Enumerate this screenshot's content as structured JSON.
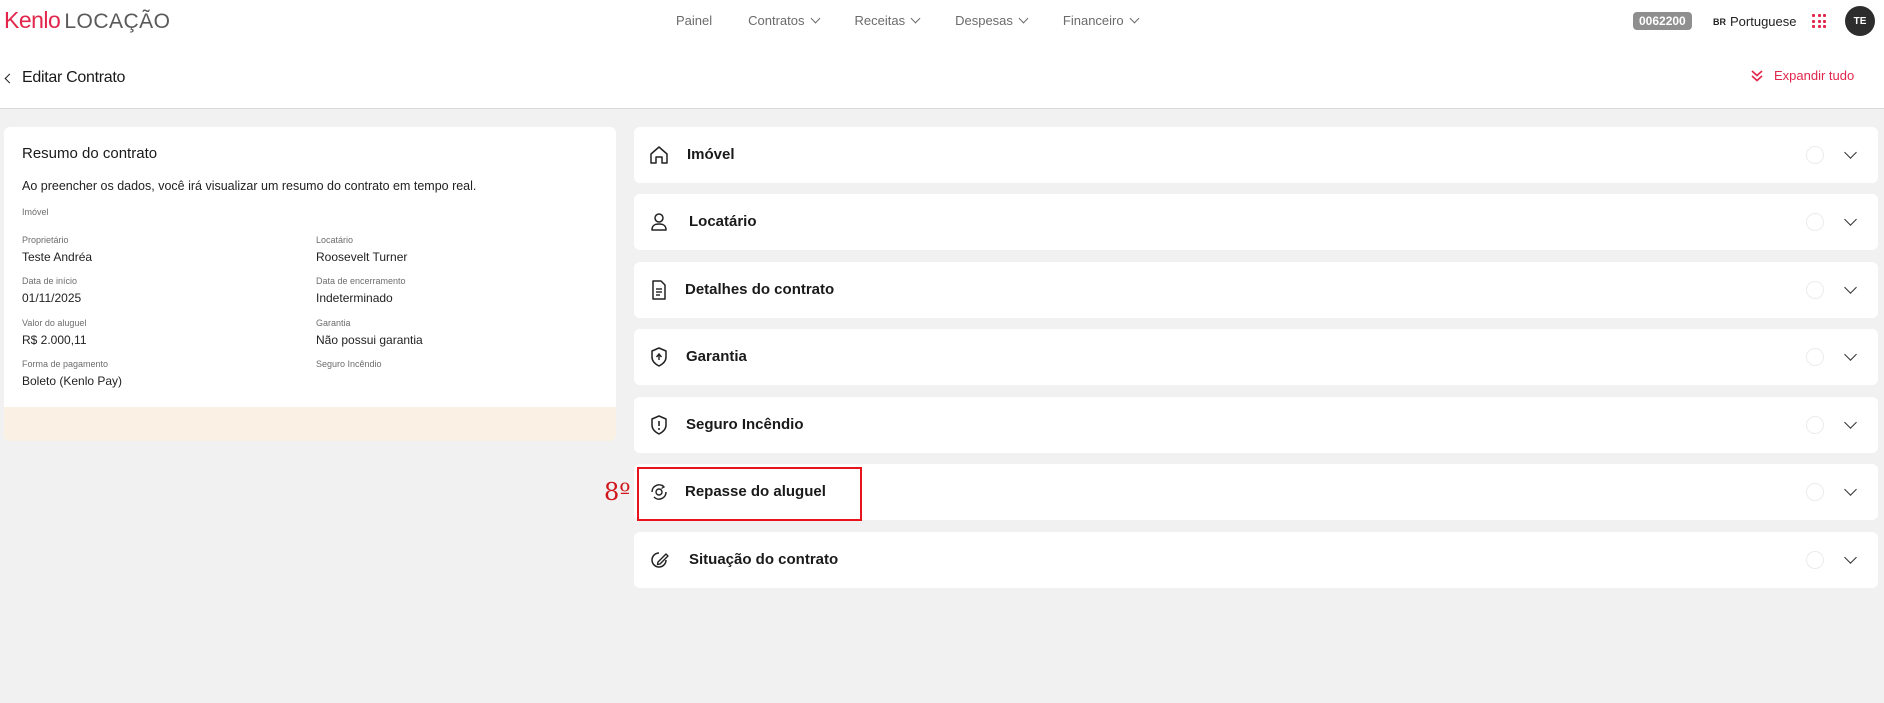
{
  "topbar": {
    "logo_brand": "Kenlo",
    "logo_product": "LOCAÇÃO",
    "nav": [
      "Painel",
      "Contratos",
      "Receitas",
      "Despesas",
      "Financeiro"
    ],
    "code_badge": "0062200",
    "lang_flag": "BR",
    "lang_label": "Portuguese",
    "avatar_initials": "TE"
  },
  "header": {
    "title": "Editar Contrato",
    "expand_label": "Expandir tudo"
  },
  "summary": {
    "title": "Resumo do contrato",
    "description": "Ao preencher os dados, você irá visualizar um resumo do contrato em tempo real.",
    "imovel_label": "Imóvel",
    "fields": {
      "proprietario_label": "Proprietário",
      "proprietario_value": "Teste Andréa",
      "locatario_label": "Locatário",
      "locatario_value": "Roosevelt Turner",
      "inicio_label": "Data de início",
      "inicio_value": "01/11/2025",
      "encerramento_label": "Data de encerramento",
      "encerramento_value": "Indeterminado",
      "aluguel_label": "Valor do aluguel",
      "aluguel_value": "R$ 2.000,11",
      "garantia_label": "Garantia",
      "garantia_value": "Não possui garantia",
      "pagamento_label": "Forma de pagamento",
      "pagamento_value": "Boleto (Kenlo Pay)",
      "seguro_label": "Seguro Incêndio"
    }
  },
  "sections": [
    {
      "label": "Imóvel",
      "icon": "home-icon"
    },
    {
      "label": "Locatário",
      "icon": "person-icon"
    },
    {
      "label": "Detalhes do contrato",
      "icon": "document-icon"
    },
    {
      "label": "Garantia",
      "icon": "shield-icon"
    },
    {
      "label": "Seguro Incêndio",
      "icon": "shield-alert-icon"
    },
    {
      "label": "Repasse do aluguel",
      "icon": "transfer-icon"
    },
    {
      "label": "Situação do contrato",
      "icon": "edit-circle-icon"
    }
  ],
  "annotation": {
    "label": "8º",
    "color": "#e8131b"
  },
  "colors": {
    "brand": "#e2264b",
    "background": "#f1f1f1",
    "summary_footer": "#faf1e4"
  }
}
